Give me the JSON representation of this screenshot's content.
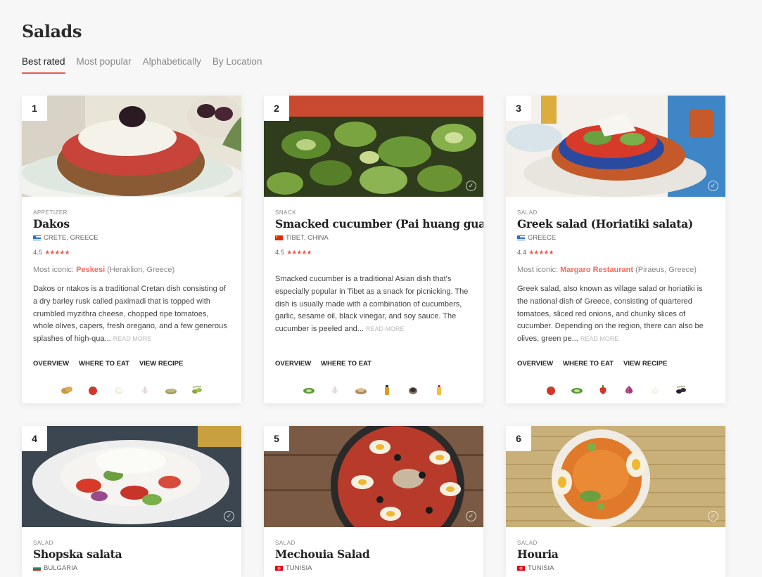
{
  "page": {
    "title": "Salads"
  },
  "tabs": [
    "Best rated",
    "Most popular",
    "Alphabetically",
    "By Location"
  ],
  "cards": [
    {
      "rank": "1",
      "category": "APPETIZER",
      "name": "Dakos",
      "location": "CRETE, GREECE",
      "rating": "4.5",
      "stars": "★★★★★",
      "iconic_label": "Most iconic:",
      "iconic_place": "Peskesi",
      "iconic_where": "(Heraklion, Greece)",
      "description": "Dakos or ntakos is a traditional Cretan dish consisting of a dry barley rusk called paximadi that is topped with crumbled myzithra cheese, chopped ripe tomatoes, whole olives, capers, fresh oregano, and a few generous splashes of high-qua...",
      "read_more": "READ MORE",
      "links": [
        "OVERVIEW",
        "WHERE TO EAT",
        "VIEW RECIPE"
      ]
    },
    {
      "rank": "2",
      "category": "SNACK",
      "name": "Smacked cucumber (Pai huang gua)",
      "location": "TIBET, CHINA",
      "rating": "4.5",
      "stars": "★★★★★",
      "description": "Smacked cucumber is a traditional Asian dish that's especially popular in Tibet as a snack for picnicking. The dish is usually made with a combination of cucumbers, garlic, sesame oil, black vinegar, and soy sauce. The cucumber is peeled and...",
      "read_more": "READ MORE",
      "links": [
        "OVERVIEW",
        "WHERE TO EAT"
      ]
    },
    {
      "rank": "3",
      "category": "SALAD",
      "name": "Greek salad (Horiatiki salata)",
      "location": "GREECE",
      "rating": "4.4",
      "stars": "★★★★★",
      "iconic_label": "Most iconic:",
      "iconic_place": "Margaro Restaurant",
      "iconic_where": "(Piraeus, Greece)",
      "description": "Greek salad, also known as village salad or horiatiki is the national dish of Greece, consisting of quartered tomatoes, sliced red onions, and chunky slices of cucumber. Depending on the region, there can also be olives, green pe...",
      "read_more": "READ MORE",
      "links": [
        "OVERVIEW",
        "WHERE TO EAT",
        "VIEW RECIPE"
      ]
    },
    {
      "rank": "4",
      "category": "SALAD",
      "name": "Shopska salata",
      "location": "BULGARIA"
    },
    {
      "rank": "5",
      "category": "SALAD",
      "name": "Mechouia Salad",
      "location": "TUNISIA"
    },
    {
      "rank": "6",
      "category": "SALAD",
      "name": "Houria",
      "location": "TUNISIA"
    }
  ],
  "colors": {
    "accent": "#e85a50",
    "iconic": "#f06c60"
  }
}
